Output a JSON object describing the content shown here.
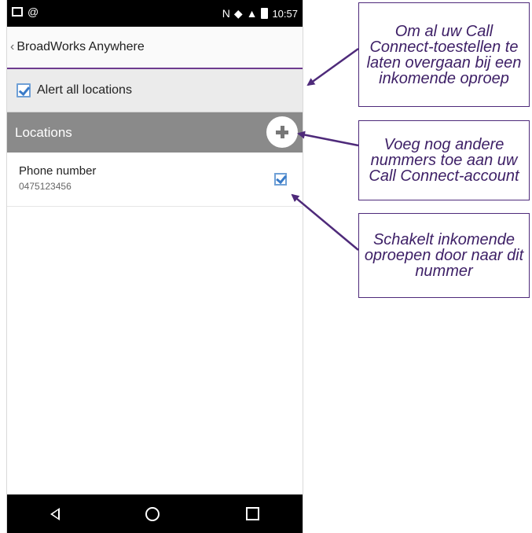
{
  "status_bar": {
    "time": "10:57"
  },
  "app_bar": {
    "title": "BroadWorks Anywhere",
    "back_glyph": "‹"
  },
  "alert": {
    "label": "Alert all locations",
    "checked": true
  },
  "locations": {
    "header": "Locations"
  },
  "phone_entry": {
    "label": "Phone number",
    "number": "0475123456",
    "checked": true
  },
  "callouts": [
    {
      "text": "Om al uw Call Connect-toestellen te laten overgaan bij een inkomende oproep"
    },
    {
      "text": "Voeg nog andere nummers toe aan uw Call Connect-account"
    },
    {
      "text": "Schakelt inkomende oproepen door naar dit nummer"
    }
  ],
  "colors": {
    "accent": "#6e3b8f",
    "callout_text": "#3d1f66",
    "locations_bar": "#8a8a8a",
    "checkbox": "#3a7bc8"
  },
  "icons": [
    "gallery-icon",
    "at-icon",
    "nfc-icon",
    "wifi-icon",
    "signal-icon",
    "battery-icon",
    "add-icon",
    "nav-back-icon",
    "nav-home-icon",
    "nav-recent-icon"
  ]
}
